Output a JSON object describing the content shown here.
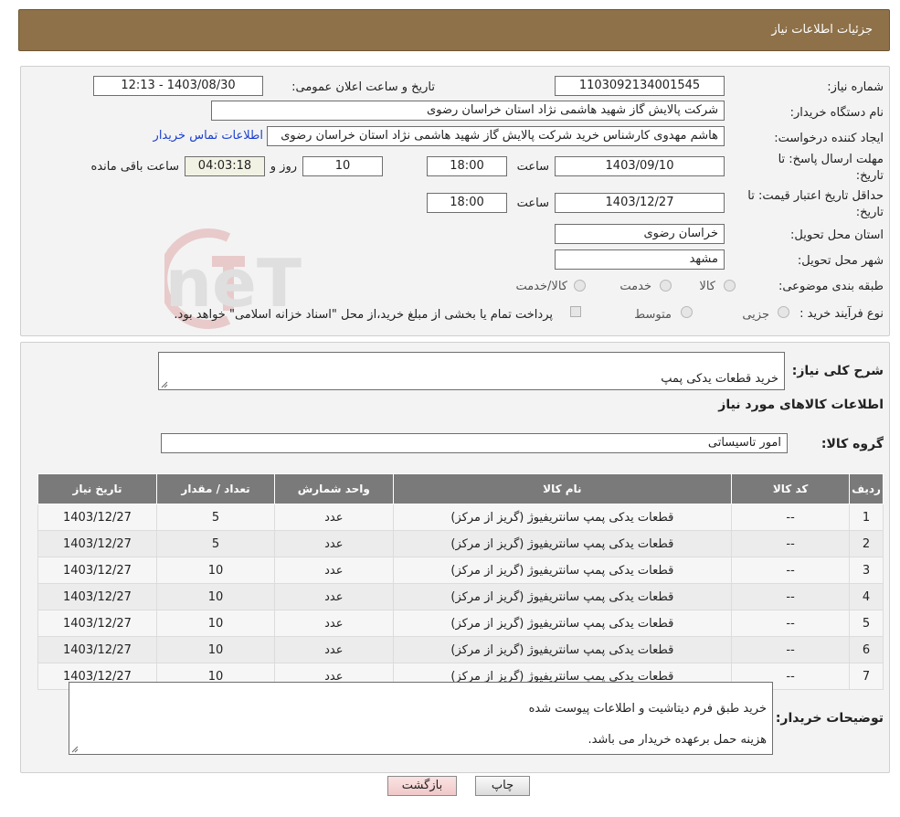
{
  "header": {
    "title": "جزئیات اطلاعات نیاز"
  },
  "form": {
    "need_number_label": "شماره نیاز:",
    "need_number": "1103092134001545",
    "announce_label": "تاریخ و ساعت اعلان عمومی:",
    "announce_value": "1403/08/30 - 12:13",
    "buyer_org_label": "نام دستگاه خریدار:",
    "buyer_org": "شرکت پالایش گاز شهید هاشمی نژاد   استان خراسان رضوی",
    "creator_label": "ایجاد کننده درخواست:",
    "creator": "هاشم مهدوی کارشناس خرید شرکت پالایش گاز شهید هاشمی نژاد   استان خراسان رضوی",
    "contact_link": "اطلاعات تماس خریدار",
    "reply_deadline_label": "مهلت ارسال پاسخ: تا تاریخ:",
    "reply_date": "1403/09/10",
    "time_label": "ساعت",
    "reply_time": "18:00",
    "days_value": "10",
    "days_label": "روز و",
    "remaining_time": "04:03:18",
    "remaining_label": "ساعت باقی مانده",
    "validity_label": "حداقل تاریخ اعتبار قیمت: تا تاریخ:",
    "validity_date": "1403/12/27",
    "validity_time": "18:00",
    "province_label": "استان محل تحویل:",
    "province": "خراسان رضوی",
    "city_label": "شهر محل تحویل:",
    "city": "مشهد",
    "category_label": "طبقه بندی موضوعی:",
    "category_options": [
      "کالا",
      "خدمت",
      "کالا/خدمت"
    ],
    "process_label": "نوع فرآیند خرید :",
    "process_options": [
      "جزیی",
      "متوسط"
    ],
    "payment_note": "پرداخت تمام یا بخشی از مبلغ خرید،از محل \"اسناد خزانه اسلامی\" خواهد بود."
  },
  "details": {
    "summary_label": "شرح کلی نیاز:",
    "summary": "خرید قطعات یدکی پمپ",
    "goods_info_title": "اطلاعات کالاهای مورد نیاز",
    "group_label": "گروه کالا:",
    "group_value": "امور تاسیساتی",
    "table": {
      "headers": [
        "ردیف",
        "کد کالا",
        "نام کالا",
        "واحد شمارش",
        "تعداد / مقدار",
        "تاریخ نیاز"
      ],
      "rows": [
        [
          "1",
          "--",
          "قطعات یدکی پمپ سانتریفیوژ (گریز از مرکز)",
          "عدد",
          "5",
          "1403/12/27"
        ],
        [
          "2",
          "--",
          "قطعات یدکی پمپ سانتریفیوژ (گریز از مرکز)",
          "عدد",
          "5",
          "1403/12/27"
        ],
        [
          "3",
          "--",
          "قطعات یدکی پمپ سانتریفیوژ (گریز از مرکز)",
          "عدد",
          "10",
          "1403/12/27"
        ],
        [
          "4",
          "--",
          "قطعات یدکی پمپ سانتریفیوژ (گریز از مرکز)",
          "عدد",
          "10",
          "1403/12/27"
        ],
        [
          "5",
          "--",
          "قطعات یدکی پمپ سانتریفیوژ (گریز از مرکز)",
          "عدد",
          "10",
          "1403/12/27"
        ],
        [
          "6",
          "--",
          "قطعات یدکی پمپ سانتریفیوژ (گریز از مرکز)",
          "عدد",
          "10",
          "1403/12/27"
        ],
        [
          "7",
          "--",
          "قطعات یدکی پمپ سانتریفیوژ (گریز از مرکز)",
          "عدد",
          "10",
          "1403/12/27"
        ]
      ]
    },
    "buyer_notes_label": "توضیحات خریدار:",
    "buyer_notes_line1": "خرید طبق فرم دیتاشیت و اطلاعات پیوست شده",
    "buyer_notes_line2": "هزینه حمل برعهده خریدار می باشد."
  },
  "buttons": {
    "print": "چاپ",
    "back": "بازگشت"
  },
  "watermark": {
    "text": "AriaTender.neT"
  },
  "colors": {
    "header_bg": "#8e7148",
    "table_header_bg": "#7a7a7a",
    "link": "#1a3fd0",
    "back_button": "#f6d4d4"
  }
}
